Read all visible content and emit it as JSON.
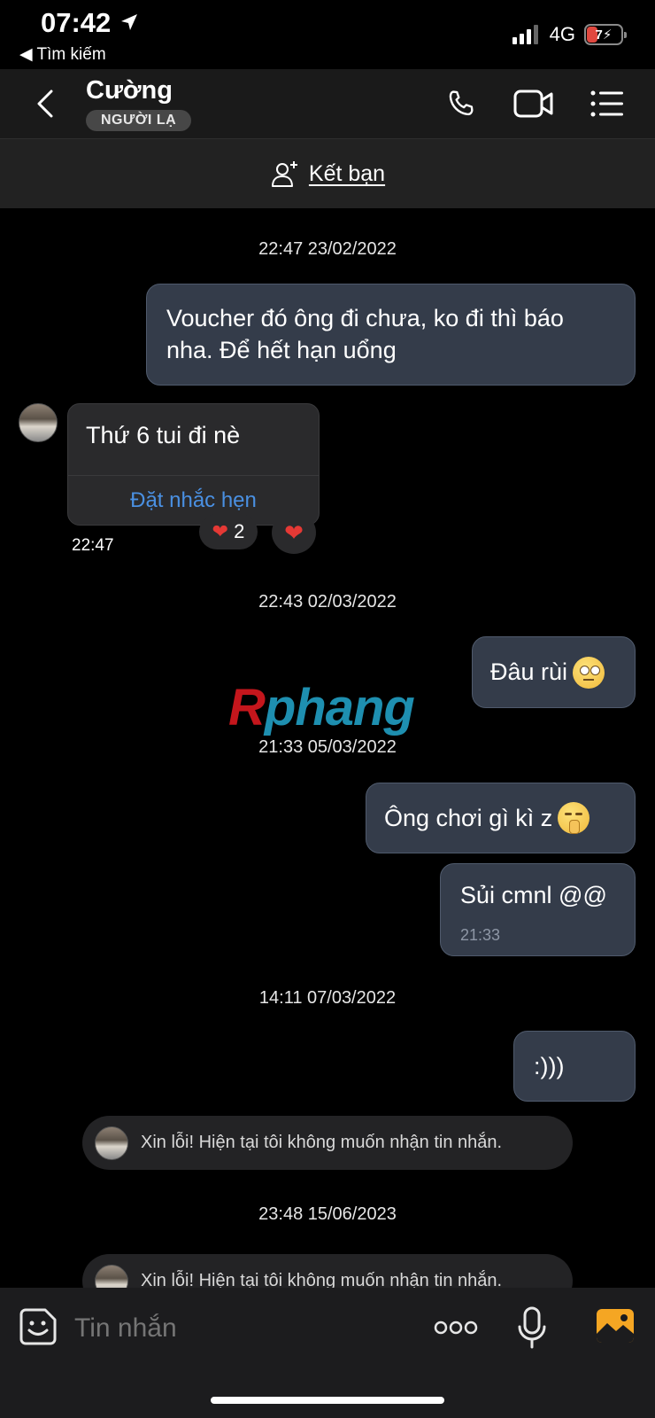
{
  "status_bar": {
    "time": "07:42",
    "back_label": "◀ Tìm kiếm",
    "network": "4G",
    "battery_level": "7"
  },
  "header": {
    "contact_name": "Cường",
    "stranger_badge": "NGƯỜI LẠ"
  },
  "add_friend": {
    "label": "Kết bạn"
  },
  "messages": {
    "ts1": "22:47 23/02/2022",
    "out1": "Voucher đó ông đi chưa, ko đi thì báo nha. Để hết hạn uổng",
    "in1": "Thứ 6 tui đi nè",
    "in1_reminder": "Đặt nhắc hẹn",
    "in1_reaction_count": "2",
    "in1_time": "22:47",
    "ts2": "22:43 02/03/2022",
    "out2": "Đâu rùi",
    "watermark": "Rphang",
    "ts3": "21:33 05/03/2022",
    "out3": "Ông chơi gì kì z",
    "out4": "Sủi cmnl @@",
    "out4_time": "21:33",
    "ts4": "14:11 07/03/2022",
    "out5": ":)))",
    "sys1": "Xin lỗi! Hiện tại tôi không muốn nhận tin nhắn.",
    "ts5": "23:48 15/06/2023",
    "sys2": "Xin lỗi! Hiện tại tôi không muốn nhận tin nhắn."
  },
  "input": {
    "placeholder": "Tin nhắn"
  },
  "colors": {
    "background": "#000000",
    "outgoing_bubble": "#343c4a",
    "incoming_bubble": "#2a2a2c",
    "link_blue": "#4a90e2",
    "heart_red": "#e53935",
    "photo_orange": "#f5a623"
  },
  "icons": [
    "location-arrow-icon",
    "signal-icon",
    "battery-icon",
    "back-chevron-icon",
    "phone-icon",
    "video-call-icon",
    "menu-list-icon",
    "add-friend-icon",
    "heart-icon",
    "sticker-icon",
    "more-dots-icon",
    "microphone-icon",
    "photo-icon"
  ]
}
